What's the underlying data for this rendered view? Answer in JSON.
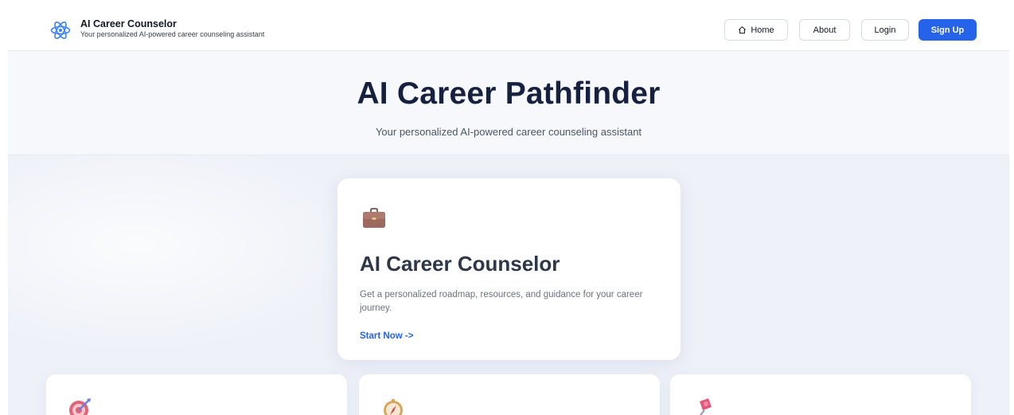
{
  "header": {
    "brand_title": "AI Career Counselor",
    "brand_subtitle": "Your personalized AI-powered career counseling assistant",
    "nav": {
      "home": "Home",
      "about": "About",
      "login": "Login",
      "signup": "Sign Up"
    }
  },
  "hero": {
    "title": "AI Career Pathfinder",
    "subtitle": "Your personalized AI-powered career counseling assistant"
  },
  "feature_card": {
    "icon": "briefcase-icon",
    "title": "AI Career Counselor",
    "description": "Get a personalized roadmap, resources, and guidance for your career journey.",
    "link": "Start Now ->"
  },
  "secondary_cards": [
    {
      "icon": "target-icon"
    },
    {
      "icon": "compass-icon"
    },
    {
      "icon": "pushpin-icon"
    }
  ],
  "colors": {
    "accent": "#2563eb",
    "heading": "#15213f",
    "background": "#eef1f8"
  }
}
